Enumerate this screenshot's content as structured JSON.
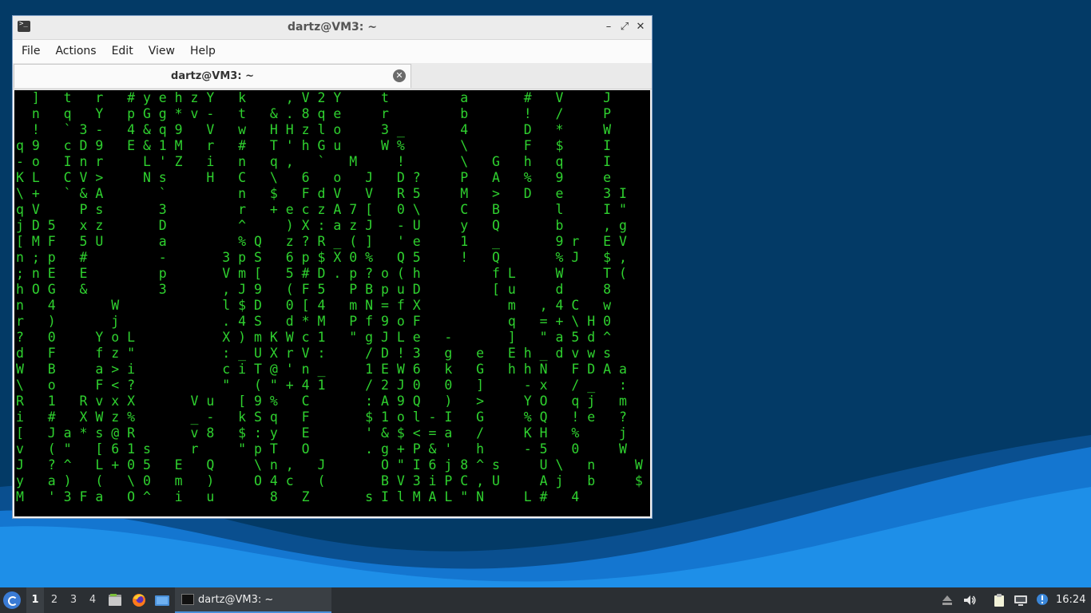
{
  "window": {
    "title": "dartz@VM3: ~",
    "controls": {
      "minimize": "–",
      "maximize": "⤢",
      "close": "✕"
    }
  },
  "menu": [
    "File",
    "Actions",
    "Edit",
    "View",
    "Help"
  ],
  "tab": {
    "title": "dartz@VM3: ~",
    "close": "✕"
  },
  "terminal": {
    "lines": [
      "  ]   t   r   # y e h z Y   k     , V 2 Y     t         a       #   V     J",
      "  n   q   Y   p G g * v -   t   & . 8 q e     r         b       !   /     P",
      "  !   ` 3 -   4 & q 9   V   w   H H z l o     3 _       4       D   *     W",
      "q 9   c D 9   E & 1 M   r   #   T ' h G u     W %       \\       F   $     I",
      "- o   I n r     L ' Z   i   n   q ,   `   M     !       \\   G   h   q     I",
      "K L   C V >     N s     H   C   \\   6   o   J   D ?     P   A   %   9     e",
      "\\ +   ` & A       `         n   $   F d V   V   R 5     M   >   D   e     3 I",
      "q V     P s       3         r   + e c z A 7 [   0 \\     C   B       l     I \"",
      "j D 5   x z       D         ^     ) X : a z J   - U     y   Q       b     , g",
      "[ M F   5 U       a         % Q   z ? R _ ( ]   ' e     1   _       9 r   E V",
      "n ; p   #         -       3 p S   6 p $ X 0 %   Q 5     !   Q       % J   $ ,",
      "; n E   E         p       V m [   5 # D . p ? o ( h         f L     W     T (",
      "h O G   &         3       , J 9   ( F 5   P B p u D         [ u     d     8",
      "n   4       W             l $ D   0 [ 4   m N = f X           m   , 4 C   w",
      "r   )       j             . 4 S   d * M   P f 9 o F           q   = + \\ H 0",
      "?   0     Y o L           X ) m K W c 1   \" g J L e   -       ]   \" a 5 d ^",
      "d   F     f z \"           : _ U X r V :     / D ! 3   g   e   E h _ d v w s",
      "W   B     a > i           c i T @ ' n _     1 E W 6   k   G   h h N   F D A a",
      "\\   o     F < ?           \"   ( \" + 4 1     / 2 J 0   0   ]     - x   / _   :",
      "R   1   R v x X       V u   [ 9 %   C       : A 9 Q   )   >     Y O   q j   m",
      "i   #   X W z %       _ -   k S q   F       $ 1 o l - I   G     % Q   ! e   ?",
      "[   J a * s @ R       v 8   $ : y   E       ' & $ < = a   /     K H   %     j",
      "v   ( \"   [ 6 1 s     r     \" p T   O       . g + P & '   h     - 5   0     W",
      "J   ? ^   L + 0 5   E   Q     \\ n ,   J       O \" I 6 j 8 ^ s     U \\   n     W",
      "y   a )   (   \\ 0   m   )     O 4 c   (       B V 3 i P C , U     A j   b     $",
      "M   ' 3 F a   O ^   i   u       8   Z       s I l M A L \" N     L #   4"
    ]
  },
  "taskbar": {
    "workspaces": [
      "1",
      "2",
      "3",
      "4"
    ],
    "task_label": "dartz@VM3: ~",
    "clock": "16:24",
    "icons": {
      "start": "lubuntu-start-icon",
      "file_manager": "file-manager-icon",
      "browser": "firefox-icon",
      "desktop": "show-desktop-icon",
      "eject": "eject-icon",
      "volume": "volume-icon",
      "clipboard": "clipboard-icon",
      "network": "network-icon",
      "updates": "update-notifier-icon"
    }
  },
  "colors": {
    "desktop_bg": "#033a66",
    "wave_light": "#1e8fe8",
    "terminal_text": "#2fd12f",
    "taskbar_bg": "#2b2f33"
  }
}
